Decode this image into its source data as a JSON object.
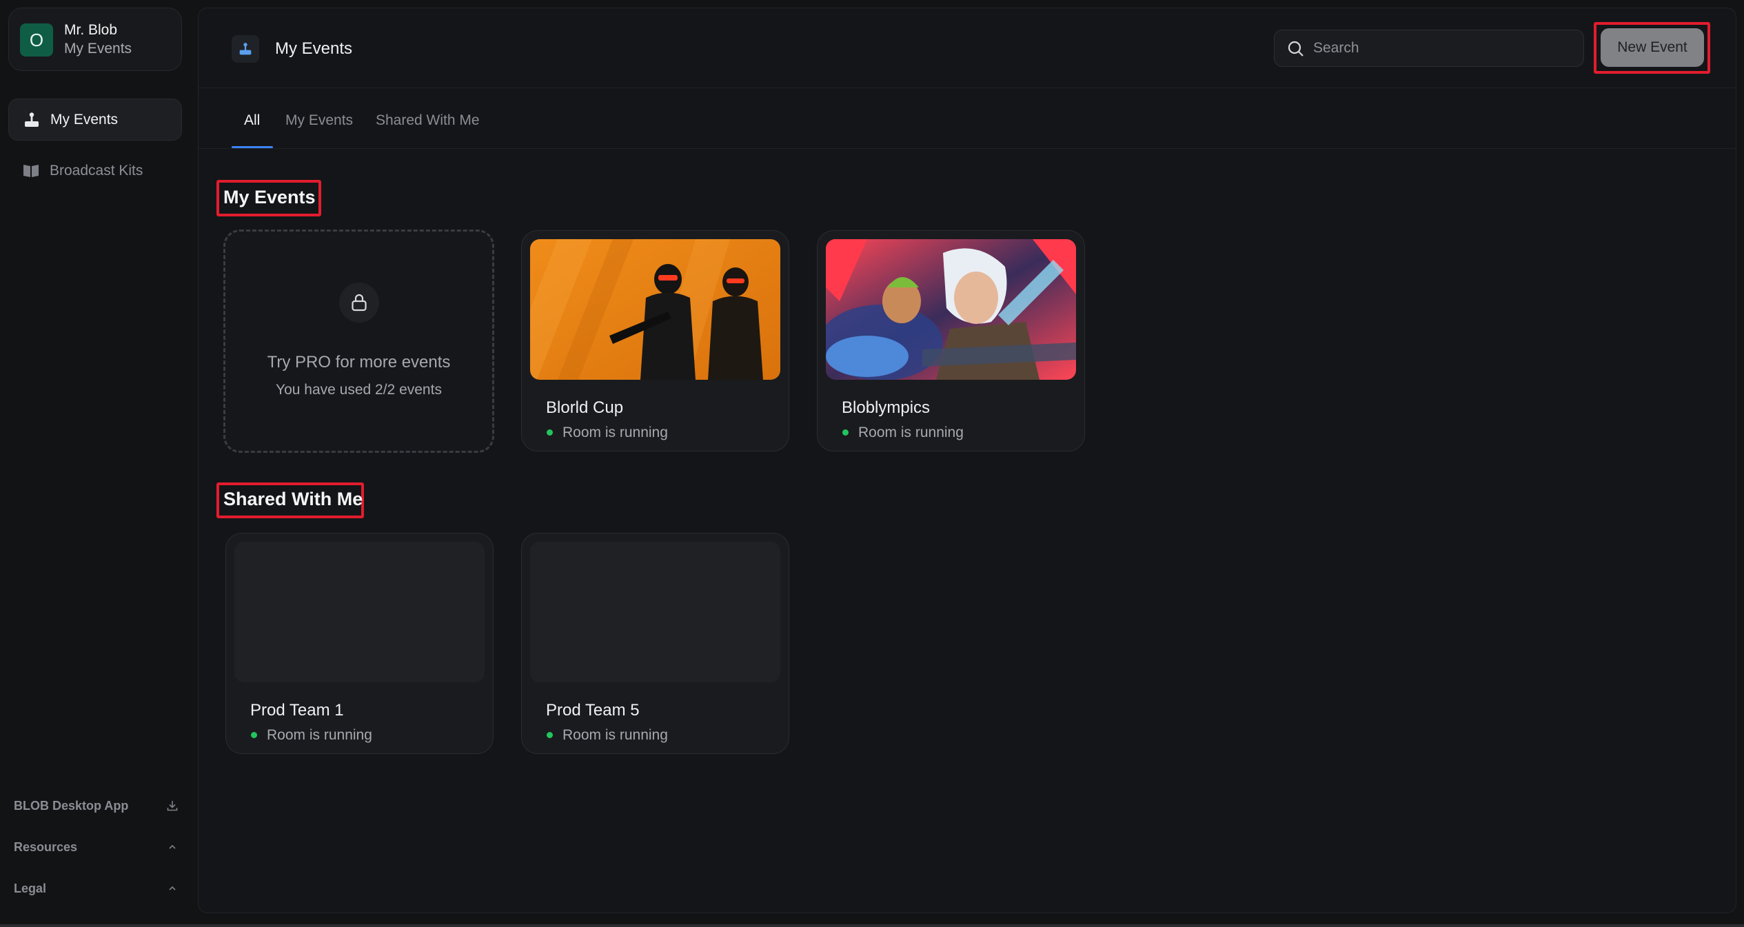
{
  "sidebar": {
    "account": {
      "initial": "O",
      "name": "Mr. Blob",
      "subtitle": "My Events"
    },
    "nav": [
      {
        "label": "My Events",
        "icon": "joystick-icon",
        "active": true
      },
      {
        "label": "Broadcast Kits",
        "icon": "book-icon",
        "active": false
      }
    ],
    "footer": [
      {
        "label": "BLOB Desktop App",
        "icon": "download-icon"
      },
      {
        "label": "Resources",
        "icon": "chevron-up-icon"
      },
      {
        "label": "Legal",
        "icon": "chevron-up-icon"
      }
    ]
  },
  "header": {
    "title": "My Events",
    "search_placeholder": "Search",
    "new_event_label": "New Event"
  },
  "tabs": [
    {
      "label": "All",
      "active": true
    },
    {
      "label": "My Events",
      "active": false
    },
    {
      "label": "Shared With Me",
      "active": false
    }
  ],
  "sections": {
    "my_events": {
      "title": "My Events",
      "pro_card": {
        "title": "Try PRO for more events",
        "subtitle": "You have used 2/2 events"
      },
      "cards": [
        {
          "title": "Blorld Cup",
          "status": "Room is running"
        },
        {
          "title": "Bloblympics",
          "status": "Room is running"
        }
      ]
    },
    "shared": {
      "title": "Shared With Me",
      "cards": [
        {
          "title": "Prod Team 1",
          "status": "Room is running"
        },
        {
          "title": "Prod Team 5",
          "status": "Room is running"
        }
      ]
    }
  },
  "colors": {
    "accent": "#3b82f6",
    "avatar": "#0f5d45",
    "status_running": "#22c55e",
    "highlight": "#e11d2e"
  }
}
